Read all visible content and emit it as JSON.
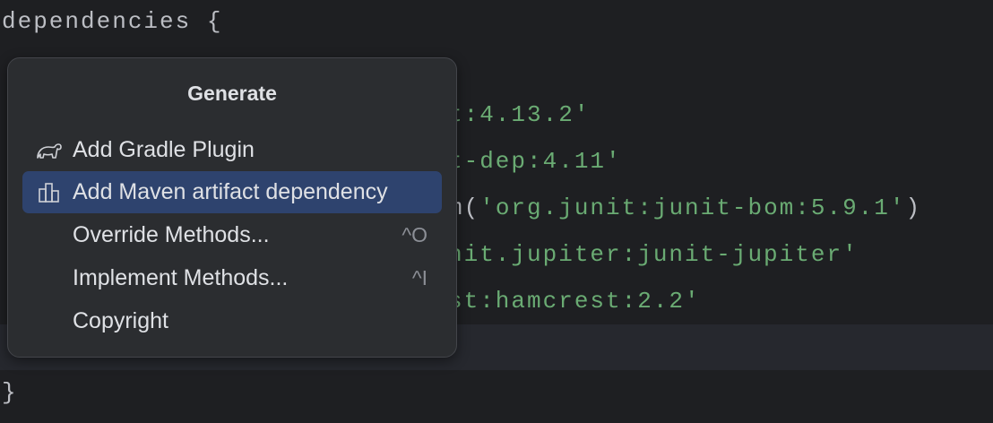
{
  "editor": {
    "line_open": "dependencies {",
    "line_close": "}",
    "fragments": [
      "t:4.13.2'",
      "t-dep:4.11'",
      {
        "prefix": "m(",
        "string": "'org.junit:junit-bom:5.9.1'",
        "suffix": ")"
      },
      "nit.jupiter:junit-jupiter'",
      "st:hamcrest:2.2'"
    ]
  },
  "popup": {
    "title": "Generate",
    "items": [
      {
        "label": "Add Gradle Plugin",
        "icon": "gradle-elephant-icon",
        "shortcut": ""
      },
      {
        "label": "Add Maven artifact dependency",
        "icon": "maven-library-icon",
        "shortcut": "",
        "selected": true
      },
      {
        "label": "Override Methods...",
        "shortcut": "^O"
      },
      {
        "label": "Implement Methods...",
        "shortcut": "^I"
      },
      {
        "label": "Copyright",
        "shortcut": ""
      }
    ]
  },
  "colors": {
    "background": "#1e1f22",
    "popup": "#2b2d30",
    "selection": "#2e436e",
    "string": "#6aab73"
  }
}
